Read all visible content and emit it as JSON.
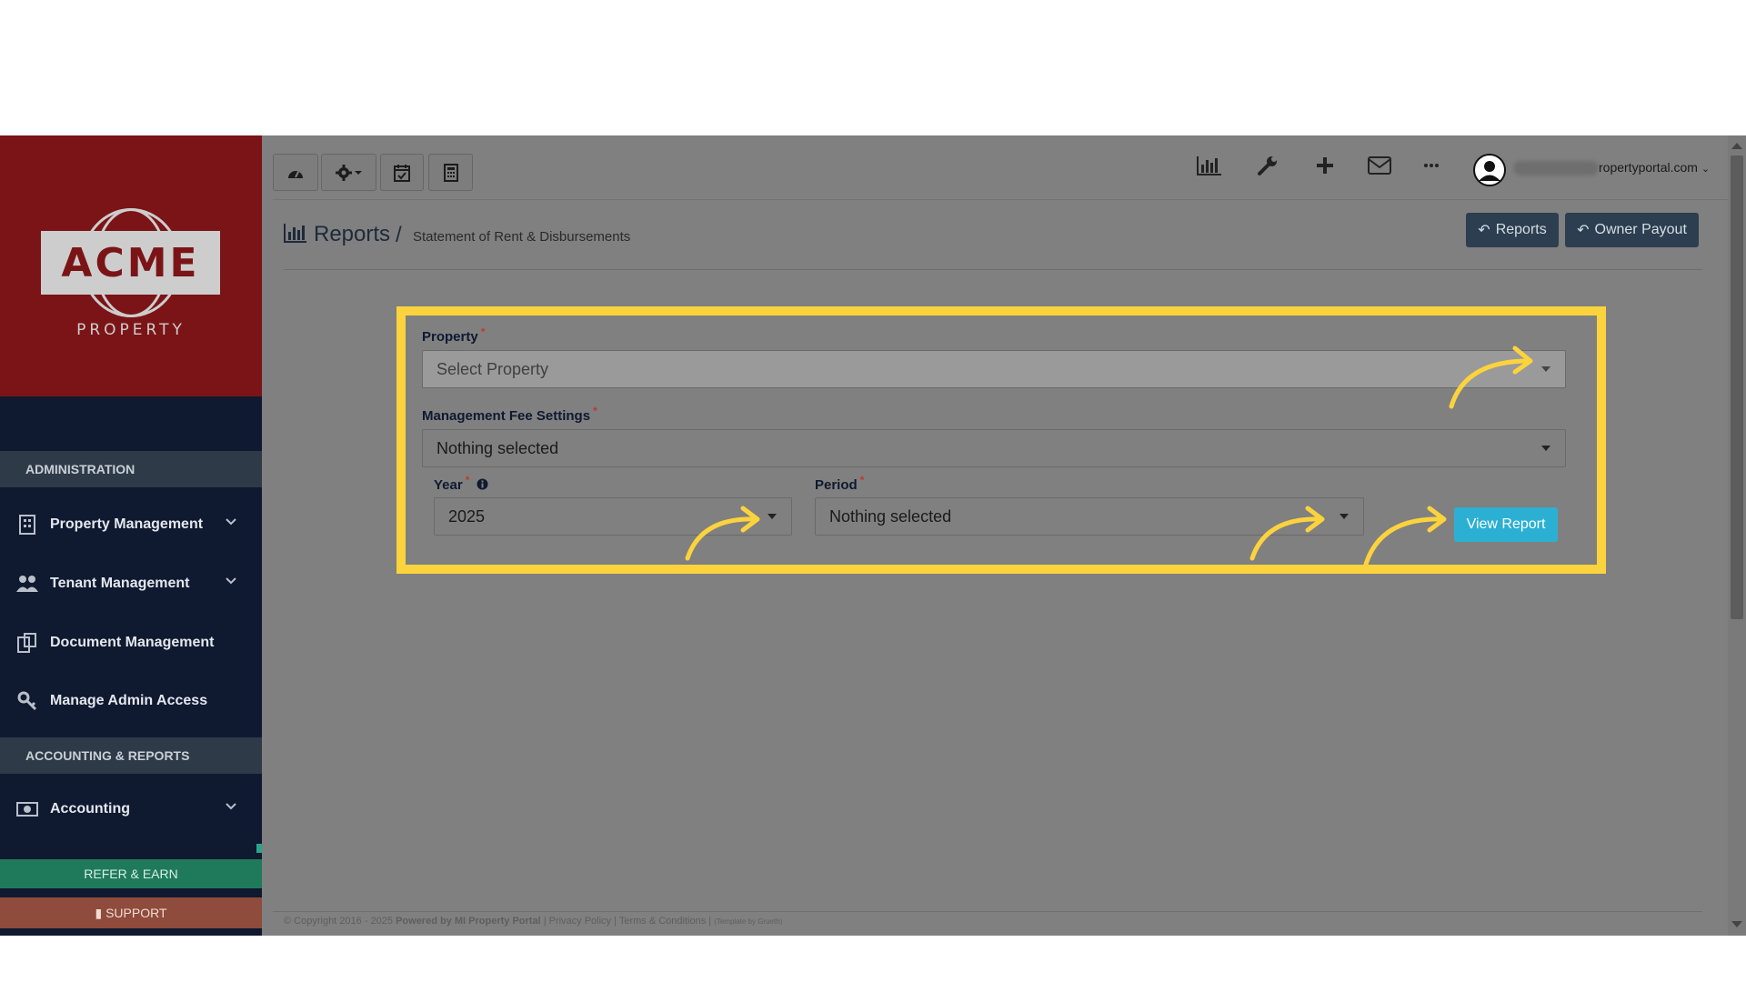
{
  "logo": {
    "brand": "ACME",
    "sub": "PROPERTY"
  },
  "sidebar": {
    "section_admin": "ADMINISTRATION",
    "items": [
      {
        "label": "Property Management",
        "icon": "building-icon",
        "expandable": true
      },
      {
        "label": "Tenant Management",
        "icon": "users-icon",
        "expandable": true
      },
      {
        "label": "Document Management",
        "icon": "documents-icon",
        "expandable": false
      },
      {
        "label": "Manage Admin Access",
        "icon": "key-icon",
        "expandable": false
      }
    ],
    "section_accounting": "ACCOUNTING & REPORTS",
    "accounting_item": {
      "label": "Accounting",
      "icon": "money-icon",
      "expandable": true
    },
    "refer_label": "REFER & EARN",
    "support_label": "SUPPORT"
  },
  "toolbar": {
    "left_buttons": [
      "dashboard-icon",
      "gear-icon",
      "calendar-check-icon",
      "calculator-icon"
    ],
    "right_icons": [
      "bar-chart-icon",
      "wrench-icon",
      "plus-icon",
      "envelope-icon",
      "more-icon"
    ],
    "user_email": "ropertyportal.com"
  },
  "header": {
    "title": "Reports",
    "separator": "/",
    "subtitle": "Statement of Rent & Disbursements",
    "reports_button": "Reports",
    "owner_payout_button": "Owner Payout"
  },
  "form": {
    "property_label": "Property",
    "property_placeholder": "Select Property",
    "fee_label": "Management Fee Settings",
    "fee_value": "Nothing selected",
    "year_label": "Year",
    "year_value": "2025",
    "period_label": "Period",
    "period_value": "Nothing selected",
    "required_mark": "*",
    "view_report_button": "View Report"
  },
  "footer": {
    "copyright": "© Copyright 2016 - 2025",
    "powered_by": "Powered by MI Property Portal",
    "links": "| Privacy Policy | Terms & Conditions |",
    "template": "(Template by Grueth)"
  },
  "colors": {
    "highlight": "#fcd33d",
    "sidebar": "#0f1930",
    "logo_bg": "#7b1416",
    "primary_button": "#2bb0d4",
    "dark_button": "#2c3e50",
    "refer": "#1f7a5c",
    "support": "#8f4b3b"
  }
}
